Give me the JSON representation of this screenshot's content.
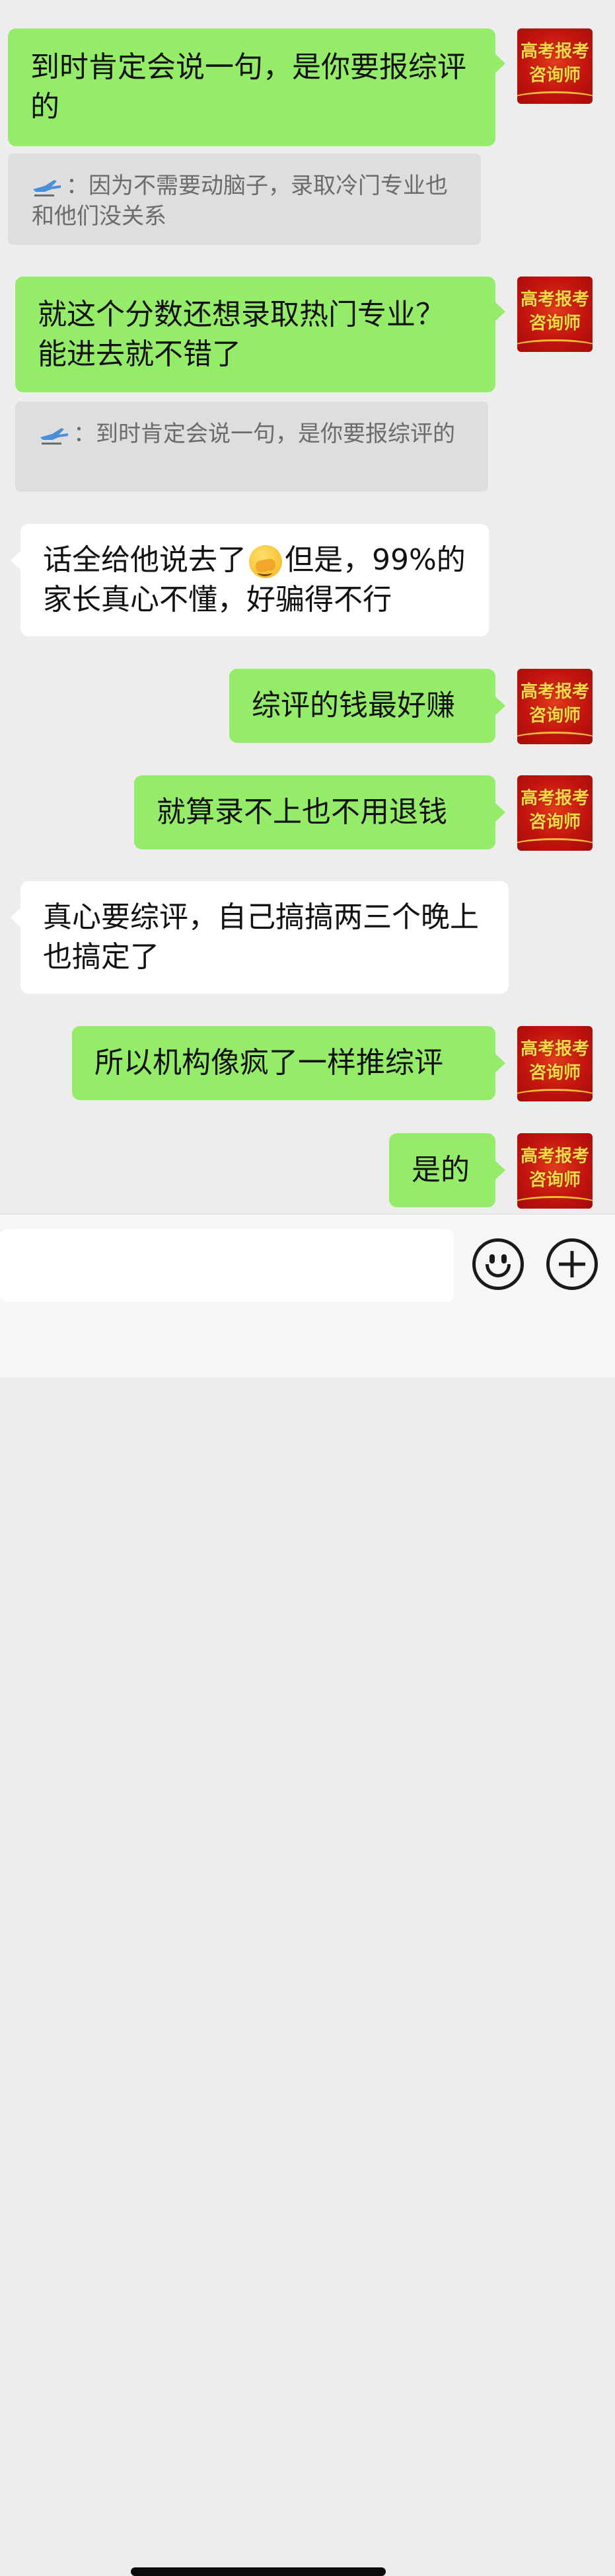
{
  "avatar": {
    "line1": "高考报考",
    "line2": "咨询师"
  },
  "messages": [
    {
      "side": "out",
      "text": "到时肯定会说一句，是你要报综评的"
    },
    {
      "side": "quote",
      "sender_icon": "plane-icon",
      "text": "：因为不需要动脑子，录取冷门专业也和他们没关系"
    },
    {
      "side": "out",
      "text": "就这个分数还想录取热门专业？能进去就不错了"
    },
    {
      "side": "quote",
      "sender_icon": "plane-icon",
      "text": "：到时肯定会说一句，是你要报综评的"
    },
    {
      "side": "in",
      "text_before_emoji": "话全给他说去了",
      "emoji": "face-with-hand-over-mouth",
      "text_after_emoji": "但是，99%的家长真心不懂，好骗得不行"
    },
    {
      "side": "out",
      "text": "综评的钱最好赚"
    },
    {
      "side": "out",
      "text": "就算录不上也不用退钱"
    },
    {
      "side": "in",
      "text": "真心要综评，自己搞搞两三个晚上也搞定了"
    },
    {
      "side": "out",
      "text": "所以机构像疯了一样推综评"
    },
    {
      "side": "out",
      "text": "是的"
    }
  ],
  "input_bar": {
    "value": "",
    "emoji_button": "smiley-icon",
    "more_button": "plus-icon"
  },
  "colors": {
    "background": "#ededed",
    "outgoing_bubble": "#95ec69",
    "incoming_bubble": "#ffffff",
    "quote_bubble": "#dedede"
  }
}
